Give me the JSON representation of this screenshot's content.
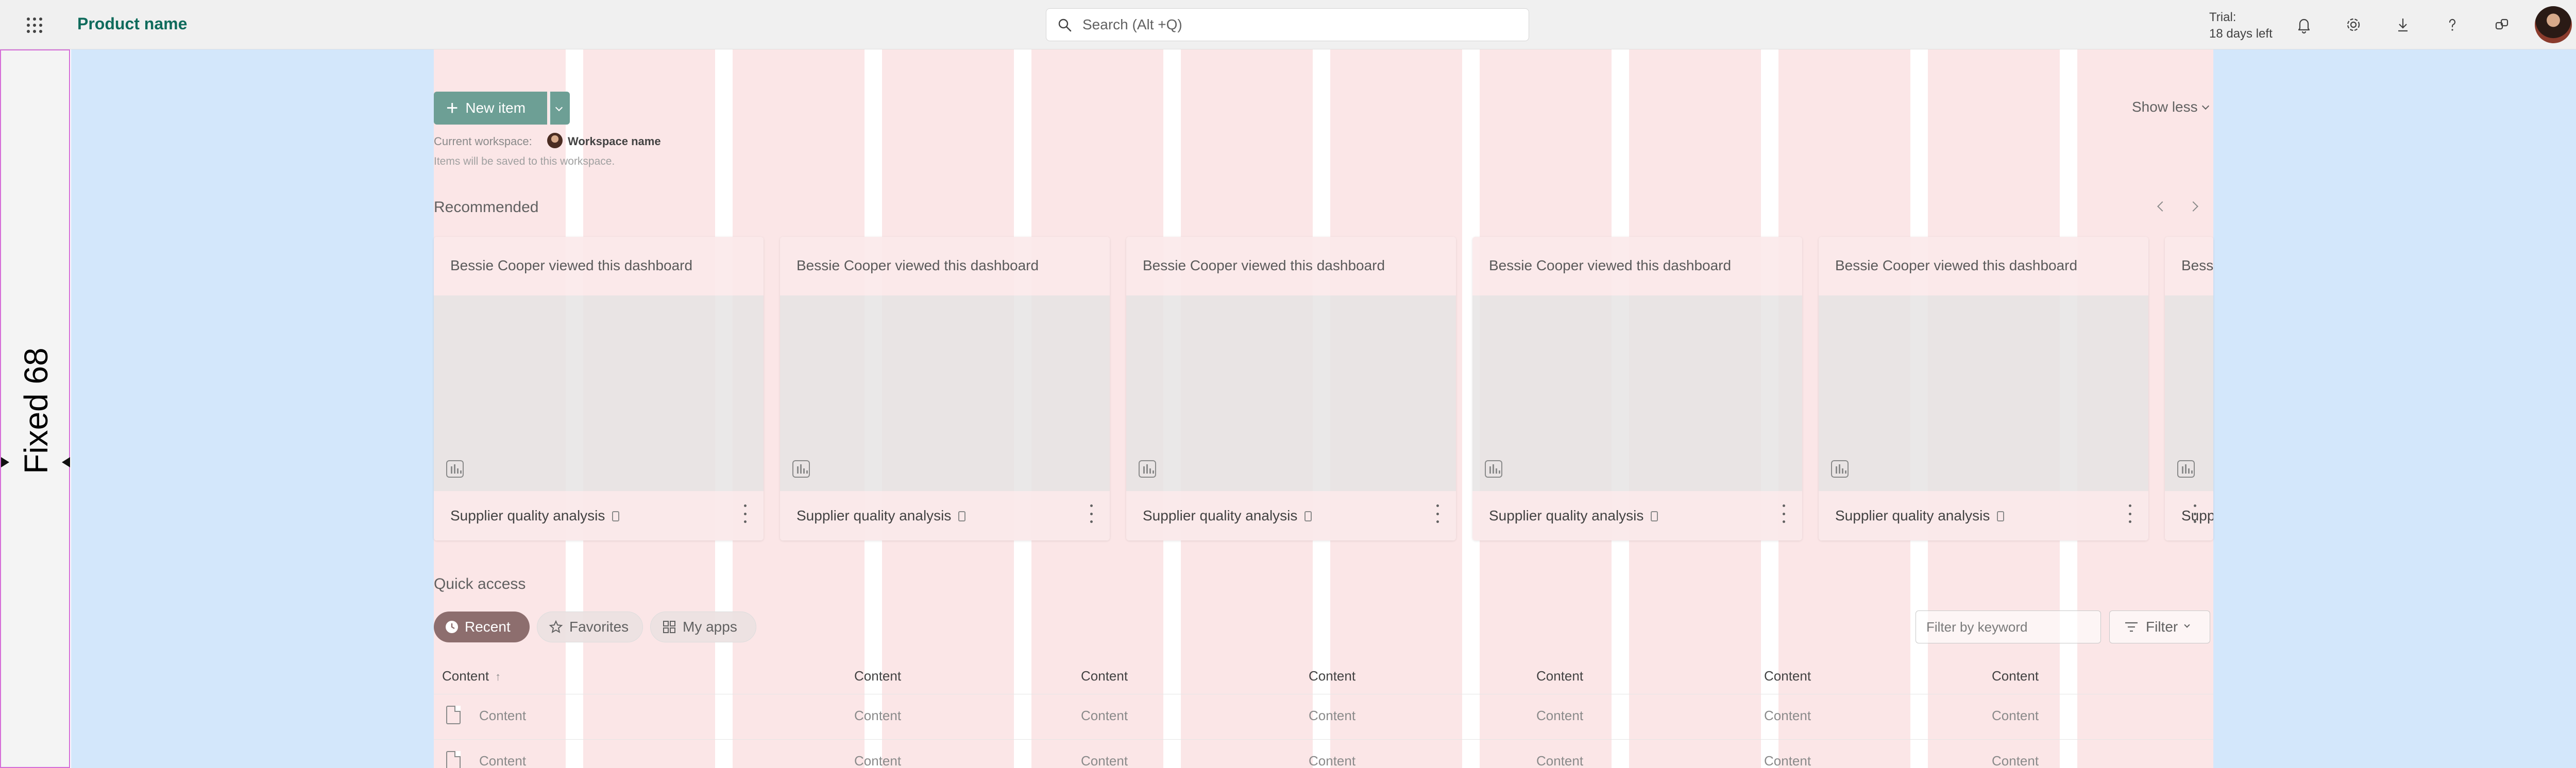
{
  "topbar": {
    "product_name": "Product name",
    "search_placeholder": "Search (Alt +Q)",
    "trial_line1": "Trial:",
    "trial_line2": "18 days left",
    "icons": [
      "bell-icon",
      "gear-icon",
      "download-icon",
      "help-icon",
      "share-icon"
    ]
  },
  "rail": {
    "label": "Fixed 68"
  },
  "toolbar": {
    "new_item": "New item",
    "show_less": "Show less",
    "current_workspace_label": "Current workspace:",
    "workspace_name": "Workspace name",
    "saved_note": "Items will be saved to this workspace."
  },
  "recommended": {
    "title": "Recommended",
    "cards": [
      {
        "activity": "Bessie Cooper viewed this dashboard",
        "title": "Supplier quality analysis"
      },
      {
        "activity": "Bessie Cooper viewed this dashboard",
        "title": "Supplier quality analysis"
      },
      {
        "activity": "Bessie Cooper viewed this dashboard",
        "title": "Supplier quality analysis"
      },
      {
        "activity": "Bessie Cooper viewed this dashboard",
        "title": "Supplier quality analysis"
      },
      {
        "activity": "Bessie Cooper viewed this dashboard",
        "title": "Supplier quality analysis"
      },
      {
        "activity": "Bessie Cooper viewed this dashboard",
        "title": "Supplier quality analysis"
      }
    ]
  },
  "quick_access": {
    "title": "Quick access",
    "pills": {
      "recent": "Recent",
      "favorites": "Favorites",
      "my_apps": "My apps"
    },
    "filter_placeholder": "Filter by keyword",
    "filter_label": "Filter"
  },
  "table": {
    "headers": [
      "Content",
      "Content",
      "Content",
      "Content",
      "Content",
      "Content",
      "Content"
    ],
    "rows": [
      [
        "Content",
        "Content",
        "Content",
        "Content",
        "Content",
        "Content",
        "Content"
      ],
      [
        "Content",
        "Content",
        "Content",
        "Content",
        "Content",
        "Content",
        "Content"
      ]
    ]
  },
  "colors": {
    "brand": "#0f6b5c",
    "primary_button": "#6d9f95",
    "grid_column": "#f8d2d4",
    "margin": "#d3e7fb",
    "rail_border": "#d56ed8"
  }
}
